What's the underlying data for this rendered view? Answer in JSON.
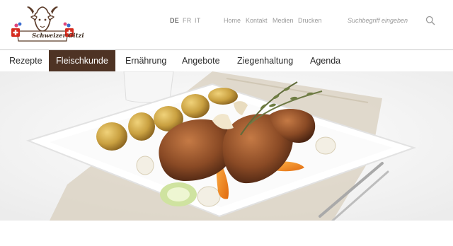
{
  "brand": {
    "logo_text": "Schweizer Gitzi"
  },
  "languages": [
    {
      "code": "DE",
      "active": true
    },
    {
      "code": "FR",
      "active": false
    },
    {
      "code": "IT",
      "active": false
    }
  ],
  "top_links": [
    "Home",
    "Kontakt",
    "Medien",
    "Drucken"
  ],
  "search": {
    "placeholder": "Suchbegriff eingeben",
    "icon": "search-icon"
  },
  "nav": {
    "items": [
      "Rezepte",
      "Fleischkunde",
      "Ernährung",
      "Angebote",
      "Ziegenhaltung",
      "Agenda"
    ],
    "active_index": 1,
    "active_color": "#4e3324"
  },
  "hero": {
    "subject": "roasted goat dish with potatoes, carrots, garlic and thyme on white plate"
  },
  "colors": {
    "accent": "#4e3324",
    "swiss_red": "#d52b1e",
    "divider": "#c9c9c9"
  }
}
